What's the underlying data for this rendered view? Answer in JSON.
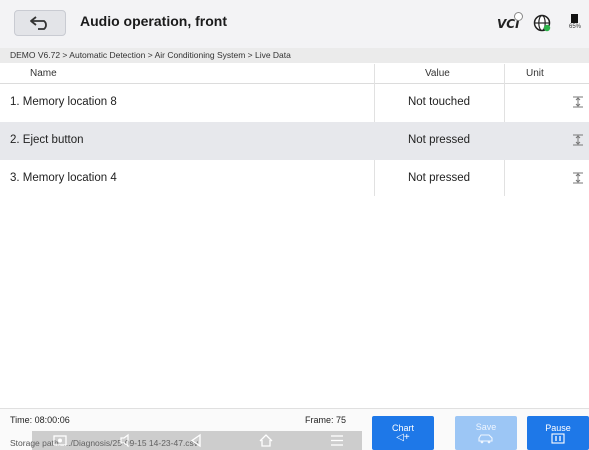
{
  "header": {
    "title": "Audio operation, front",
    "vci_label": "VCI",
    "battery_percent": "65%"
  },
  "breadcrumb": "DEMO V6.72 > Automatic Detection  > Air Conditioning System > Live Data",
  "table": {
    "columns": [
      "Name",
      "Value",
      "Unit"
    ],
    "rows": [
      {
        "name": "1. Memory location 8",
        "value": "Not touched"
      },
      {
        "name": "2. Eject button",
        "value": "Not pressed"
      },
      {
        "name": "3. Memory location 4",
        "value": "Not pressed"
      }
    ]
  },
  "footer": {
    "time": "Time: 08:00:06",
    "frame": "Frame: 75",
    "storage": "Storage path:  .../Diagnosis/25-09-15 14-23-47.csv"
  },
  "buttons": {
    "chart": "Chart",
    "save": "Save",
    "pause": "Pause"
  },
  "colors": {
    "accent": "#1e78e8",
    "header_bg": "#f3f3f5",
    "row_alt_bg": "#e7e8ec"
  }
}
